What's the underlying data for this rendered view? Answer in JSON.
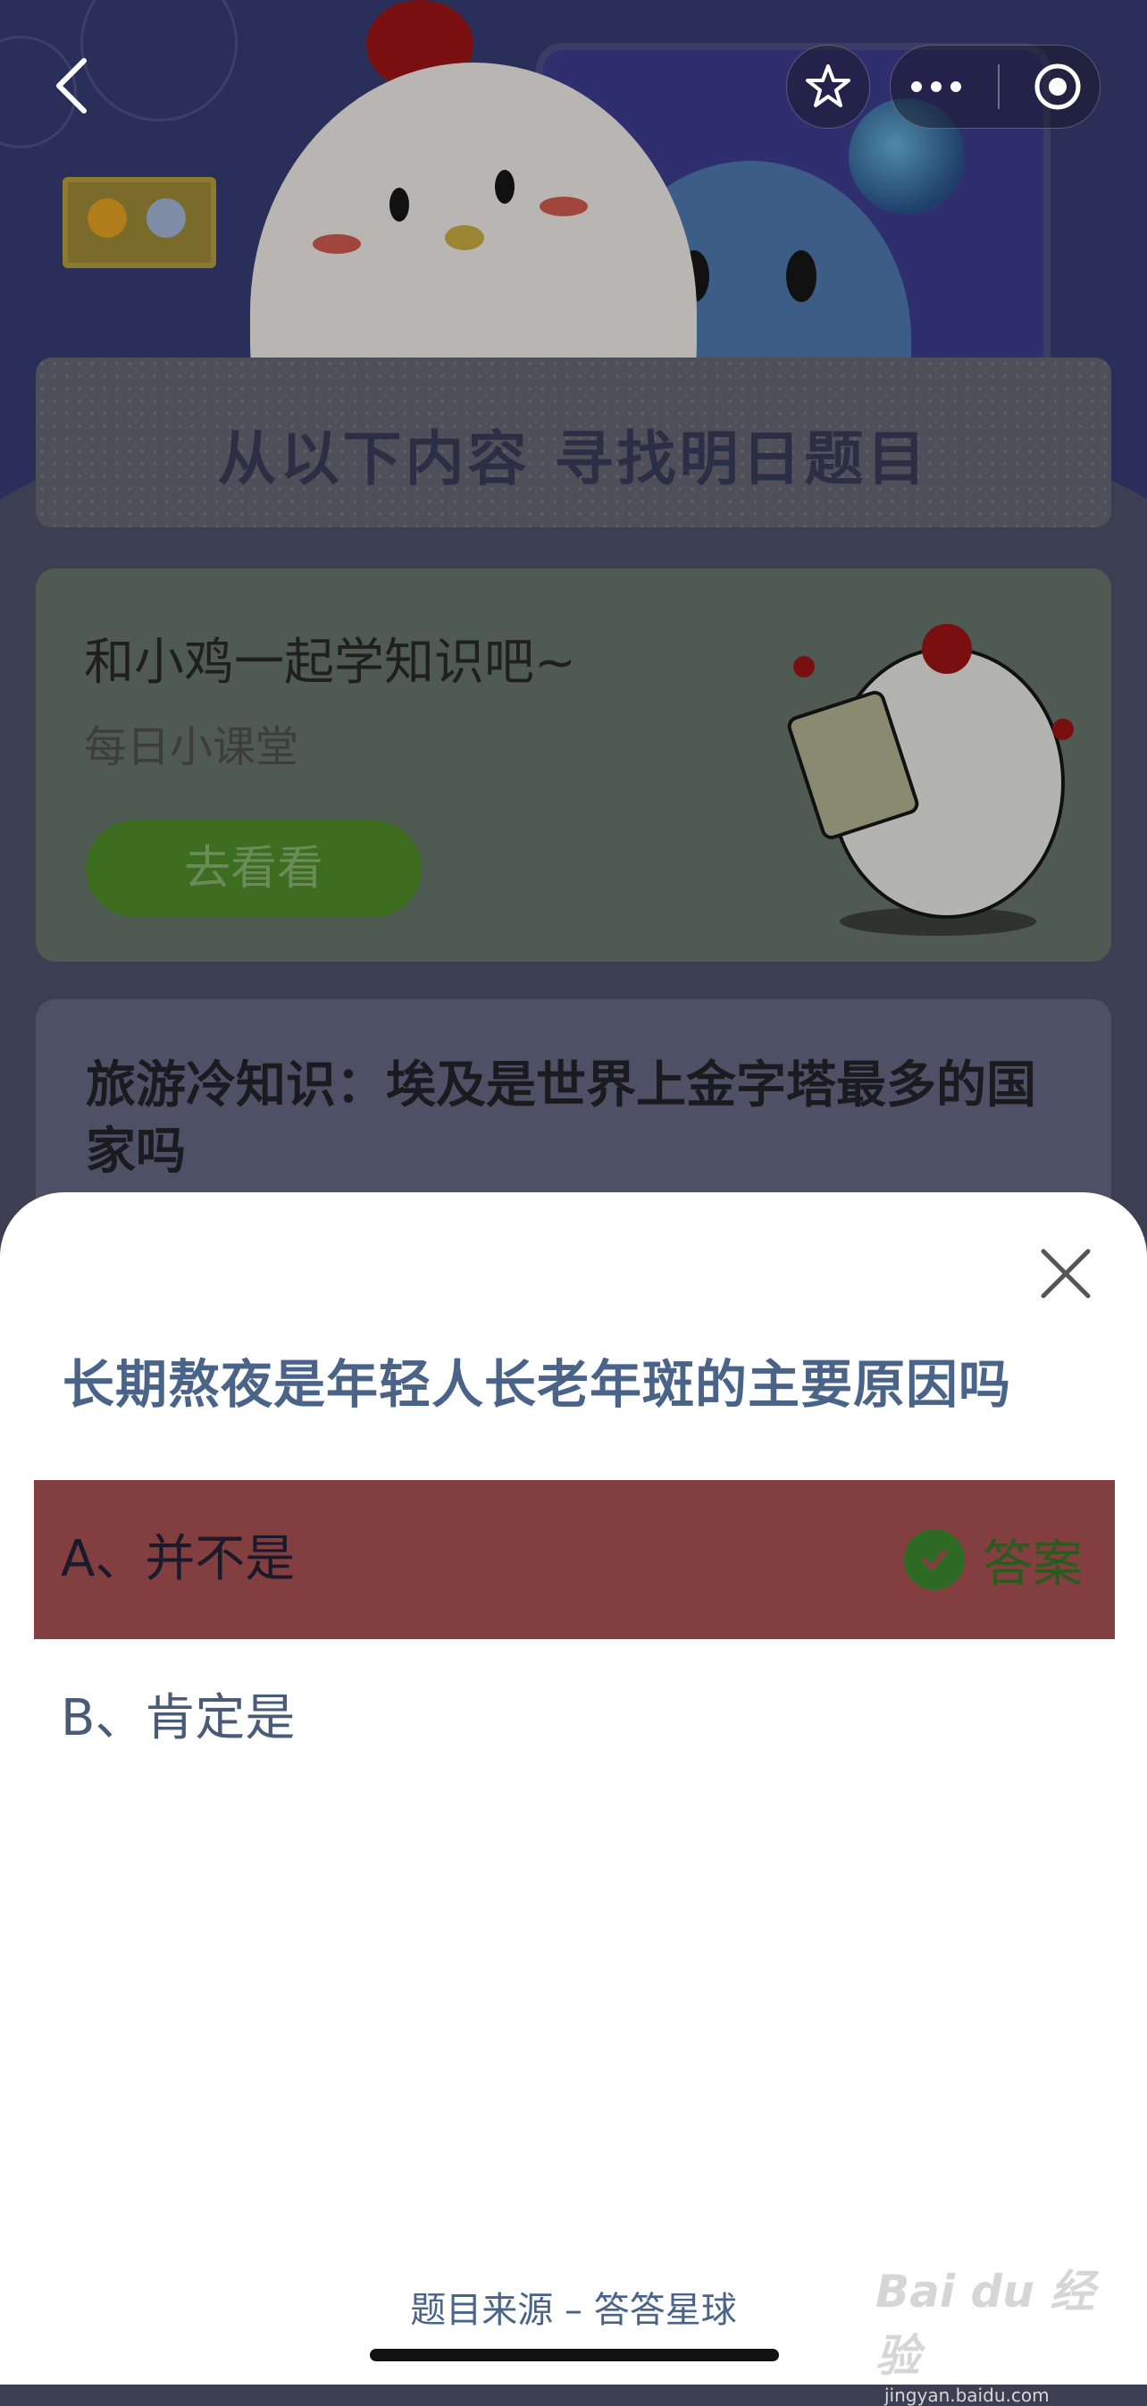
{
  "nav": {
    "back_icon": "chevron-left-icon",
    "star_icon": "star-icon",
    "more_icon": "more-dots-icon",
    "close_icon": "record-circle-icon"
  },
  "banner": {
    "title": "从以下内容  寻找明日题目"
  },
  "card1": {
    "title": "和小鸡一起学知识吧~",
    "subtitle": "每日小课堂",
    "button": "去看看"
  },
  "card2": {
    "title": "旅游冷知识：埃及是世界上金字塔最多的国家吗"
  },
  "sheet": {
    "question": "长期熬夜是年轻人长老年斑的主要原因吗",
    "options": [
      {
        "text": "A、并不是",
        "answer_label": "答案",
        "is_answer": true
      },
      {
        "text": "B、肯定是"
      }
    ],
    "source": "题目来源 – 答答星球"
  },
  "watermark": {
    "brand": "Bai du 经验",
    "url": "jingyan.baidu.com"
  },
  "colors": {
    "question_text": "#4a6388",
    "answer_highlight": "#833f40",
    "answer_check": "#2d6b25"
  }
}
